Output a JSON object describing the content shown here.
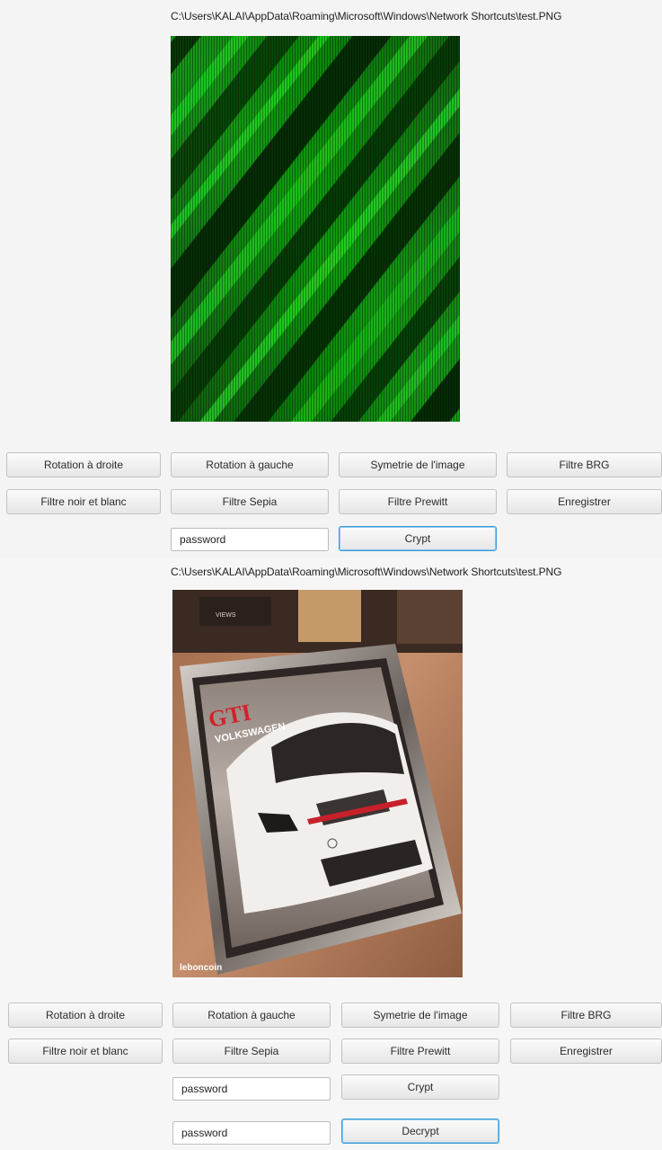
{
  "colors": {
    "background": "#f4f4f4",
    "button_border": "#c2c2c2",
    "focus_border": "#3c9ad8"
  },
  "panel1": {
    "path": "C:\\Users\\KALAI\\AppData\\Roaming\\Microsoft\\Windows\\Network Shortcuts\\test.PNG",
    "buttons": {
      "rotate_right": "Rotation à droite",
      "rotate_left": "Rotation à gauche",
      "symmetry": "Symetrie de l'image",
      "filter_brg": "Filtre BRG",
      "filter_bw": "Filtre noir et blanc",
      "filter_sepia": "Filtre Sepia",
      "filter_prewitt": "Filtre Prewitt",
      "save": "Enregistrer",
      "crypt": "Crypt"
    },
    "password_value": "password"
  },
  "panel2": {
    "path": "C:\\Users\\KALAI\\AppData\\Roaming\\Microsoft\\Windows\\Network Shortcuts\\test.PNG",
    "buttons": {
      "rotate_right": "Rotation à droite",
      "rotate_left": "Rotation à gauche",
      "symmetry": "Symetrie de l'image",
      "filter_brg": "Filtre BRG",
      "filter_bw": "Filtre noir et blanc",
      "filter_sepia": "Filtre Sepia",
      "filter_prewitt": "Filtre Prewitt",
      "save": "Enregistrer",
      "crypt": "Crypt",
      "decrypt": "Decrypt"
    },
    "password_value": "password",
    "password2_value": "password",
    "photo_labels": {
      "gti": "GTI",
      "brand": "VOLKSWAGEN",
      "watermark": "leboncoin",
      "box": "VIEWS"
    }
  }
}
